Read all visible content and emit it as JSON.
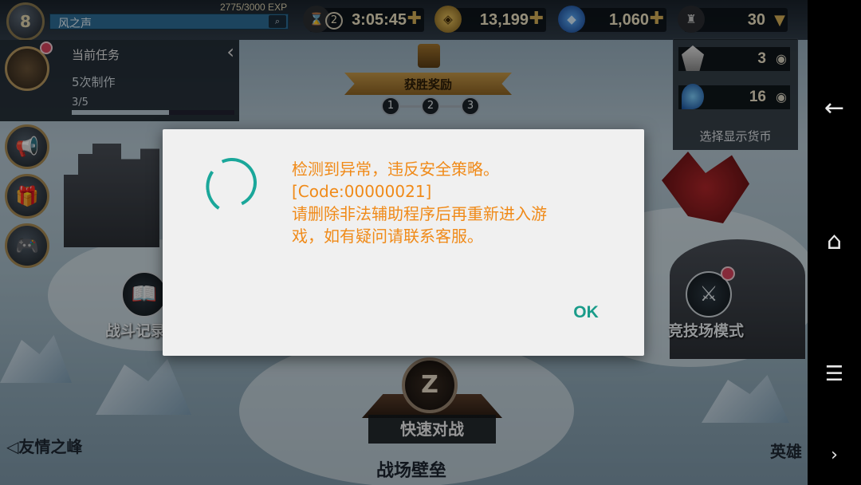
{
  "player": {
    "level": "8",
    "name": "风之声",
    "exp": "2775/3000 EXP",
    "search_icon": "search-icon"
  },
  "resources": {
    "timer": {
      "icon": "hourglass-icon",
      "count": "2",
      "value": "3:05:45"
    },
    "gold": {
      "icon": "coin-icon",
      "value": "13,199"
    },
    "gems": {
      "icon": "gem-icon",
      "value": "1,060"
    },
    "trophy": {
      "icon": "trophy-icon",
      "value": "30"
    }
  },
  "currency_panel": {
    "rows": [
      {
        "icon": "crystal-icon",
        "value": "3"
      },
      {
        "icon": "blue-flame-icon",
        "value": "16"
      }
    ],
    "label": "选择显示货币"
  },
  "mission": {
    "title": "当前任务",
    "task": "5次制作",
    "progress": "3/5",
    "progress_fraction": 0.6
  },
  "reward": {
    "title": "获胜奖励",
    "steps": [
      "1",
      "2",
      "3"
    ]
  },
  "modes": {
    "battle_record": "战斗记录",
    "arena": "竞技场模式",
    "quick_battle": "快速对战",
    "quick_emblem": "Z"
  },
  "map": {
    "left_nav": "◁友情之峰",
    "right_nav": "英雄",
    "bottom_title": "战场壁垒"
  },
  "dialog": {
    "lines": [
      "检测到异常，违反安全策略。",
      "[Code:00000021]",
      "请删除非法辅助程序后再重新进入游",
      "戏，如有疑问请联系客服。"
    ],
    "ok": "OK",
    "accent": "#1aa79a",
    "text_color": "#f08a18"
  },
  "navigation_bar": {
    "back": "←",
    "home": "⌂",
    "menu": "☰",
    "more": "›"
  }
}
